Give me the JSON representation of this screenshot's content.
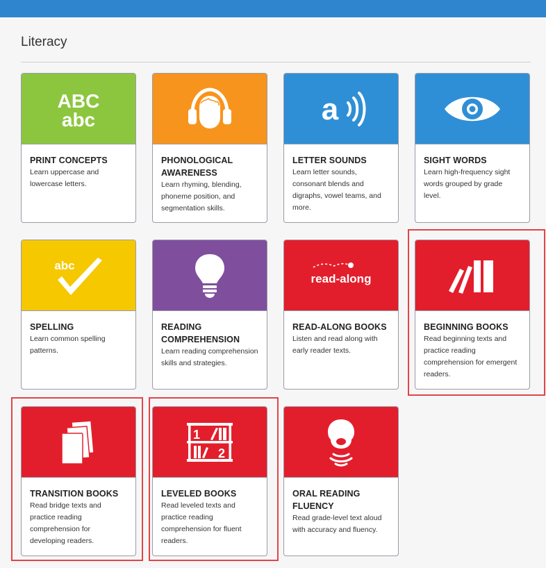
{
  "section": {
    "title": "Literacy"
  },
  "cards": [
    {
      "title": "PRINT CONCEPTS",
      "desc": "Learn uppercase and lowercase letters.",
      "color": "#8cc63f",
      "icon": "abc-letters-icon",
      "icon_upper": "ABC",
      "icon_lower": "abc"
    },
    {
      "title": "PHONOLOGICAL AWARENESS",
      "desc": "Learn rhyming, blending, phoneme position, and segmentation skills.",
      "color": "#f7941d",
      "icon": "headphones-head-icon"
    },
    {
      "title": "LETTER SOUNDS",
      "desc": "Learn letter sounds, consonant blends and digraphs, vowel teams, and more.",
      "color": "#2f8fd6",
      "icon": "letter-sound-icon",
      "icon_text": "a"
    },
    {
      "title": "SIGHT WORDS",
      "desc": "Learn high-frequency sight words grouped by grade level.",
      "color": "#2f8fd6",
      "icon": "eye-icon"
    },
    {
      "title": "SPELLING",
      "desc": "Learn common spelling patterns.",
      "color": "#f5c800",
      "icon": "abc-checkmark-icon",
      "icon_text": "abc"
    },
    {
      "title": "READING COMPREHENSION",
      "desc": "Learn reading comprehension skills and strategies.",
      "color": "#7f4f9e",
      "icon": "lightbulb-icon"
    },
    {
      "title": "READ-ALONG BOOKS",
      "desc": "Listen and read along with early reader texts.",
      "color": "#e31e2c",
      "icon": "read-along-icon",
      "icon_text": "read-along"
    },
    {
      "title": "BEGINNING BOOKS",
      "desc": "Read beginning texts and practice reading comprehension for emergent readers.",
      "color": "#e31e2c",
      "icon": "leaning-books-icon"
    },
    {
      "title": "TRANSITION BOOKS",
      "desc": "Read bridge texts and practice reading comprehension for developing readers.",
      "color": "#e31e2c",
      "icon": "book-stack-icon"
    },
    {
      "title": "LEVELED BOOKS",
      "desc": "Read leveled texts and practice reading comprehension for fluent readers.",
      "color": "#e31e2c",
      "icon": "bookshelf-icon",
      "icon_num1": "1",
      "icon_num2": "2"
    },
    {
      "title": "ORAL READING FLUENCY",
      "desc": "Read grade-level text aloud with accuracy and fluency.",
      "color": "#e31e2c",
      "icon": "speaking-head-icon"
    }
  ],
  "highlight_color": "#e0444a"
}
